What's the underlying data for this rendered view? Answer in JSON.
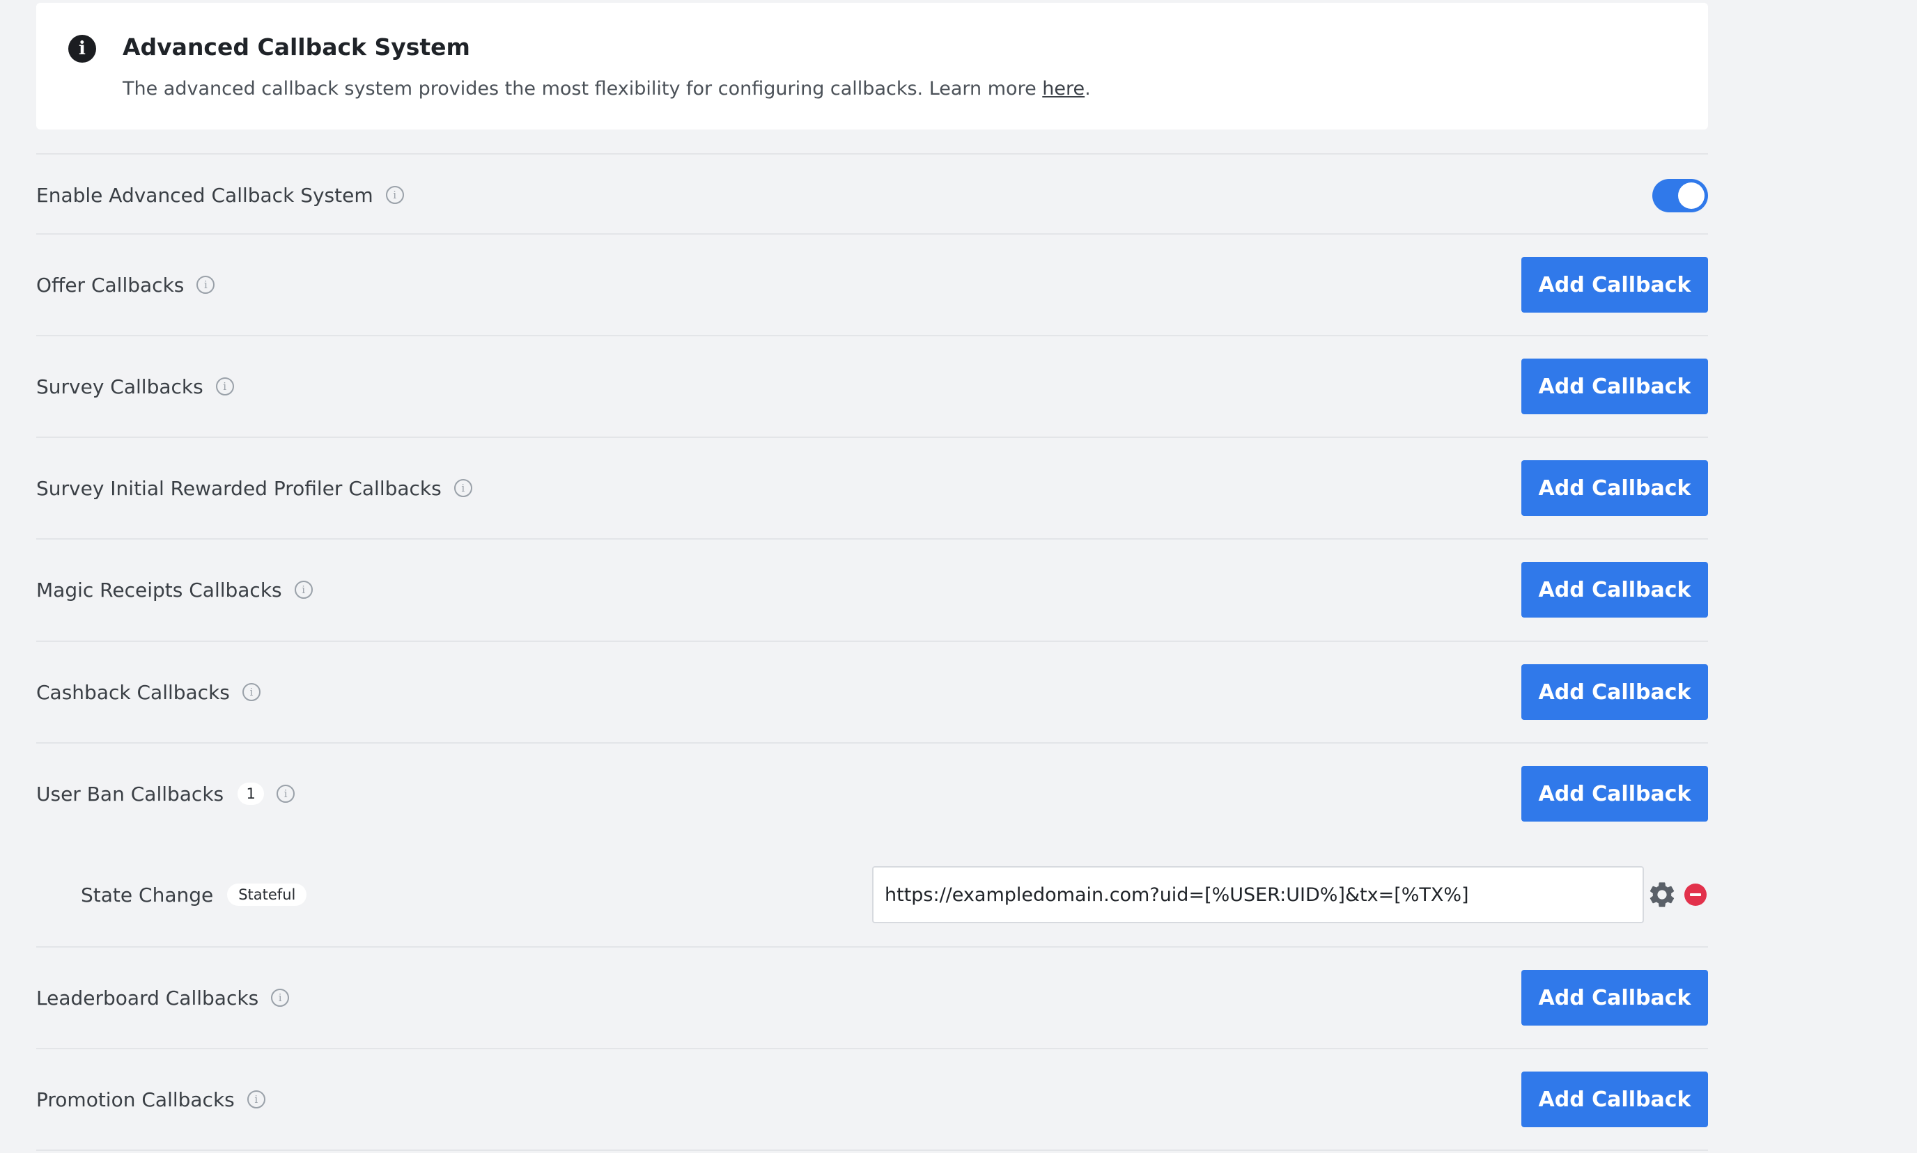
{
  "banner": {
    "icon": "info-filled-icon",
    "title": "Advanced Callback System",
    "text": "The advanced callback system provides the most flexibility for configuring callbacks. Learn more ",
    "link_text": "here",
    "text_suffix": "."
  },
  "enable_row": {
    "label": "Enable Advanced Callback System",
    "toggle_on": true
  },
  "rows": [
    {
      "label": "Offer Callbacks",
      "button_label": "Add Callback"
    },
    {
      "label": "Survey Callbacks",
      "button_label": "Add Callback"
    },
    {
      "label": "Survey Initial Rewarded Profiler Callbacks",
      "button_label": "Add Callback"
    },
    {
      "label": "Magic Receipts Callbacks",
      "button_label": "Add Callback"
    },
    {
      "label": "Cashback Callbacks",
      "button_label": "Add Callback"
    },
    {
      "label": "User Ban Callbacks",
      "count": "1",
      "button_label": "Add Callback"
    },
    {
      "label": "Leaderboard Callbacks",
      "button_label": "Add Callback"
    },
    {
      "label": "Promotion Callbacks",
      "button_label": "Add Callback"
    }
  ],
  "sub_callback": {
    "label": "State Change",
    "badge": "Stateful",
    "url": "https://exampledomain.com?uid=[%USER:UID%]&tx=[%TX%]"
  },
  "colors": {
    "accent": "#3079ea",
    "danger": "#e2314b",
    "background": "#f2f3f5"
  },
  "info_icon_glyph": "i"
}
